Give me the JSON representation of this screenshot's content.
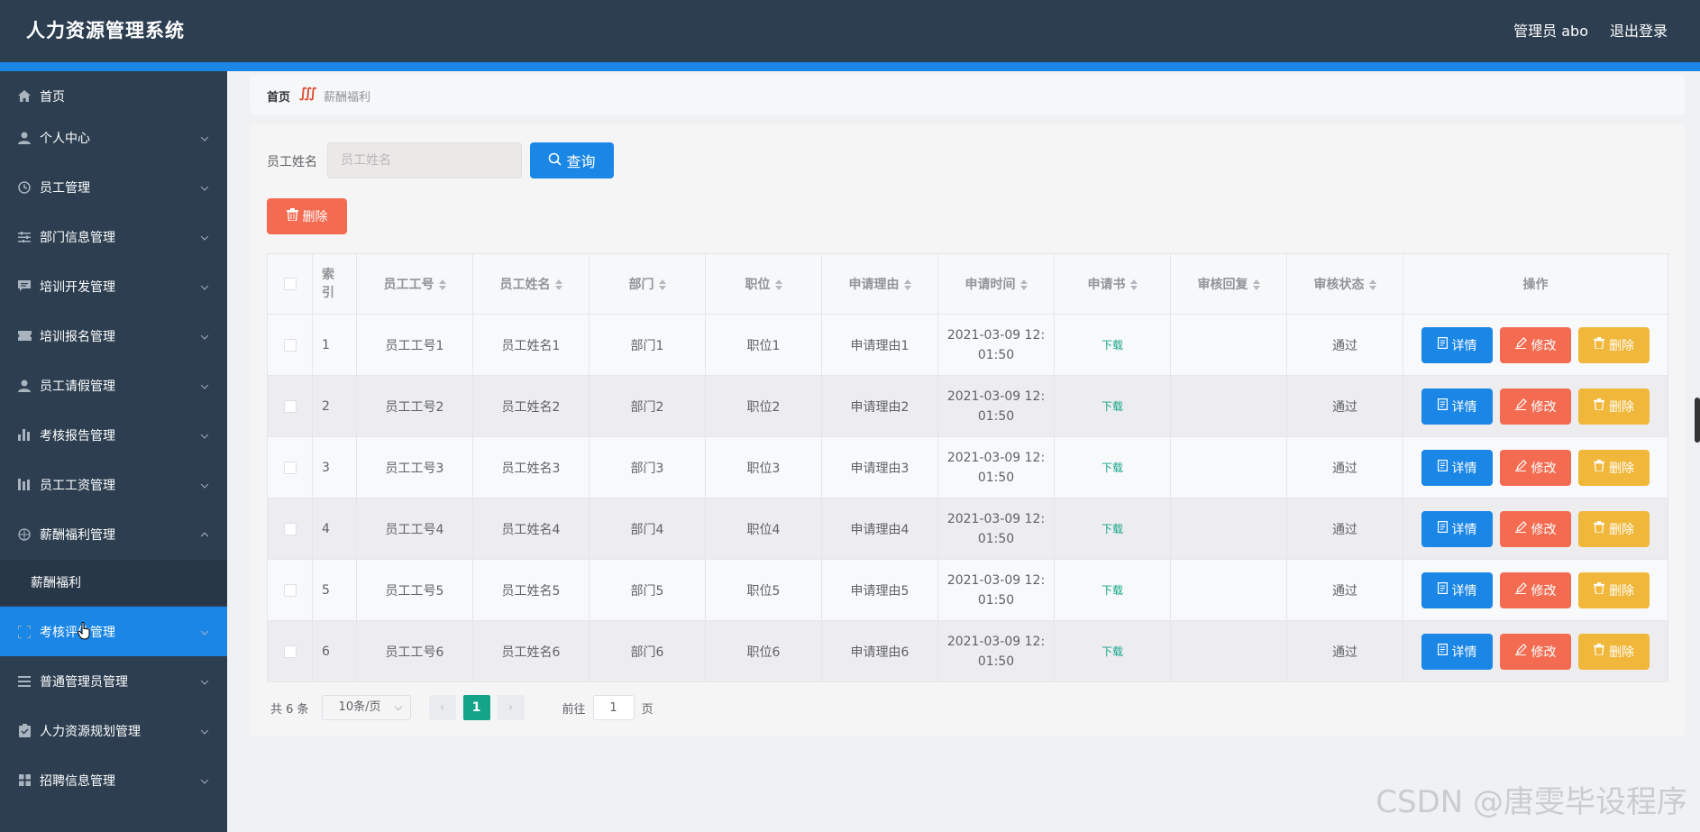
{
  "header": {
    "title": "人力资源管理系统",
    "user": "管理员 abo",
    "logout": "退出登录"
  },
  "sidebar": {
    "items": [
      {
        "label": "首页",
        "icon": "home-icon"
      },
      {
        "label": "个人中心",
        "icon": "user-icon"
      },
      {
        "label": "员工管理",
        "icon": "clock-icon"
      },
      {
        "label": "部门信息管理",
        "icon": "sliders-icon"
      },
      {
        "label": "培训开发管理",
        "icon": "chat-icon"
      },
      {
        "label": "培训报名管理",
        "icon": "ticket-icon"
      },
      {
        "label": "员工请假管理",
        "icon": "user-icon"
      },
      {
        "label": "考核报告管理",
        "icon": "bar-chart-icon"
      },
      {
        "label": "员工工资管理",
        "icon": "columns-icon"
      },
      {
        "label": "薪酬福利管理",
        "icon": "compass-icon"
      },
      {
        "label": "考核评估管理",
        "icon": "fullscreen-icon"
      },
      {
        "label": "普通管理员管理",
        "icon": "menu-icon"
      },
      {
        "label": "人力资源规划管理",
        "icon": "clipboard-icon"
      },
      {
        "label": "招聘信息管理",
        "icon": "grid-icon"
      }
    ],
    "submenu": {
      "label": "薪酬福利"
    }
  },
  "breadcrumb": {
    "home": "首页",
    "separator": "∭",
    "current": "薪酬福利"
  },
  "search": {
    "label": "员工姓名",
    "placeholder": "员工姓名",
    "button": "查询"
  },
  "toolbar": {
    "delete": "删除"
  },
  "table": {
    "headers": [
      "索引",
      "员工工号",
      "员工姓名",
      "部门",
      "职位",
      "申请理由",
      "申请时间",
      "申请书",
      "审核回复",
      "审核状态",
      "操作"
    ],
    "rows": [
      {
        "idx": "1",
        "no": "员工工号1",
        "name": "员工姓名1",
        "dept": "部门1",
        "pos": "职位1",
        "reason": "申请理由1",
        "time1": "2021-03-09 12:",
        "time2": "01:50",
        "doc": "下载",
        "reply": "",
        "status": "通过"
      },
      {
        "idx": "2",
        "no": "员工工号2",
        "name": "员工姓名2",
        "dept": "部门2",
        "pos": "职位2",
        "reason": "申请理由2",
        "time1": "2021-03-09 12:",
        "time2": "01:50",
        "doc": "下载",
        "reply": "",
        "status": "通过"
      },
      {
        "idx": "3",
        "no": "员工工号3",
        "name": "员工姓名3",
        "dept": "部门3",
        "pos": "职位3",
        "reason": "申请理由3",
        "time1": "2021-03-09 12:",
        "time2": "01:50",
        "doc": "下载",
        "reply": "",
        "status": "通过"
      },
      {
        "idx": "4",
        "no": "员工工号4",
        "name": "员工姓名4",
        "dept": "部门4",
        "pos": "职位4",
        "reason": "申请理由4",
        "time1": "2021-03-09 12:",
        "time2": "01:50",
        "doc": "下载",
        "reply": "",
        "status": "通过"
      },
      {
        "idx": "5",
        "no": "员工工号5",
        "name": "员工姓名5",
        "dept": "部门5",
        "pos": "职位5",
        "reason": "申请理由5",
        "time1": "2021-03-09 12:",
        "time2": "01:50",
        "doc": "下载",
        "reply": "",
        "status": "通过"
      },
      {
        "idx": "6",
        "no": "员工工号6",
        "name": "员工姓名6",
        "dept": "部门6",
        "pos": "职位6",
        "reason": "申请理由6",
        "time1": "2021-03-09 12:",
        "time2": "01:50",
        "doc": "下载",
        "reply": "",
        "status": "通过"
      }
    ],
    "actions": {
      "detail": "详情",
      "edit": "修改",
      "delete": "删除"
    }
  },
  "pagination": {
    "total": "共 6 条",
    "page_size": "10条/页",
    "current": "1",
    "goto": "前往",
    "jump_value": "1",
    "page_unit": "页",
    "prev": "‹",
    "next": "›"
  },
  "watermark": "CSDN @唐雯毕设程序",
  "colors": {
    "header_bg": "#2c3e50",
    "accent": "#1a86e6",
    "danger": "#f36c52",
    "warning": "#f0b73a",
    "success": "#13a48a"
  }
}
